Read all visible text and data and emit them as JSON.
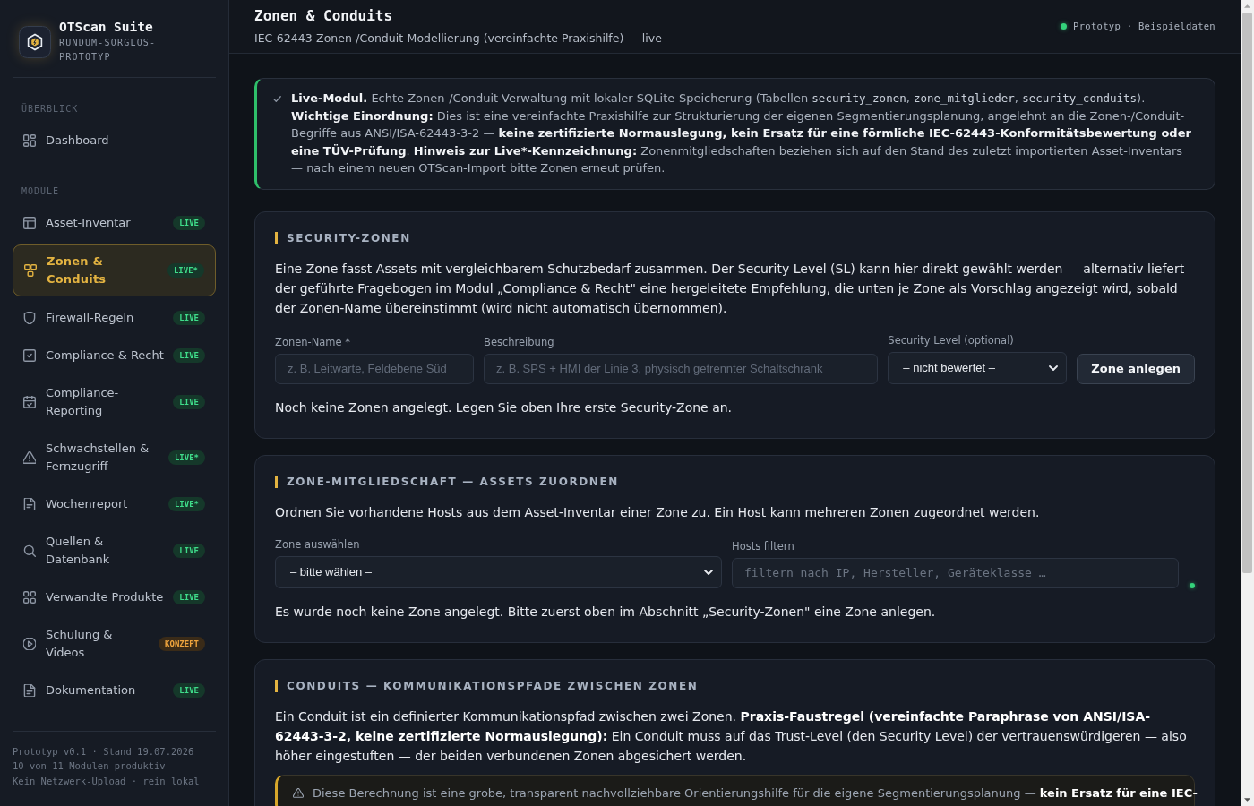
{
  "sidebar": {
    "brand": {
      "title": "OTScan Suite",
      "subtitle": "RUNDUM-SORGLOS-PROTOTYP"
    },
    "groups": [
      {
        "heading": "ÜBERBLICK",
        "items": [
          {
            "label": "Dashboard",
            "selected": false
          }
        ]
      },
      {
        "heading": "MODULE",
        "items": [
          {
            "label": "Asset-Inventar",
            "selected": false,
            "badge": {
              "text": "LIVE",
              "kind": "live"
            }
          },
          {
            "label": "Zonen & Conduits",
            "selected": true,
            "badge": {
              "text": "LIVE*",
              "kind": "live"
            }
          },
          {
            "label": "Firewall-Regeln",
            "selected": false,
            "badge": {
              "text": "LIVE",
              "kind": "live"
            }
          },
          {
            "label": "Compliance & Recht",
            "selected": false,
            "badge": {
              "text": "LIVE",
              "kind": "live"
            }
          },
          {
            "label": "Compliance-Reporting",
            "selected": false,
            "badge": {
              "text": "LIVE",
              "kind": "live"
            }
          },
          {
            "label": "Schwachstellen & Fernzugriff",
            "selected": false,
            "badge": {
              "text": "LIVE*",
              "kind": "live"
            }
          },
          {
            "label": "Wochenreport",
            "selected": false,
            "badge": {
              "text": "LIVE*",
              "kind": "live"
            }
          },
          {
            "label": "Quellen & Datenbank",
            "selected": false,
            "badge": {
              "text": "LIVE",
              "kind": "live"
            }
          },
          {
            "label": "Verwandte Produkte",
            "selected": false,
            "badge": {
              "text": "LIVE",
              "kind": "live"
            }
          },
          {
            "label": "Schulung & Videos",
            "selected": false,
            "badge": {
              "text": "KONZEPT",
              "kind": "concept"
            }
          },
          {
            "label": "Dokumentation",
            "selected": false,
            "badge": {
              "text": "LIVE",
              "kind": "live"
            }
          }
        ]
      }
    ],
    "footer": [
      "Prototyp v0.1 · Stand 19.07.2026",
      "10 von 11 Modulen produktiv",
      "Kein Netzwerk-Upload · rein lokal"
    ]
  },
  "header": {
    "title": "Zonen & Conduits",
    "subtitle": "IEC-62443-Zonen-/Conduit-Modellierung (vereinfachte Praxishilfe) — live",
    "status": "Prototyp · Beispieldaten"
  },
  "notice": {
    "segments": [
      {
        "kind": "bold",
        "text": "Live-Modul."
      },
      {
        "kind": "text",
        "text": " Echte Zonen-/Conduit-Verwaltung mit lokaler SQLite-Speicherung (Tabellen "
      },
      {
        "kind": "code",
        "text": "security_zonen"
      },
      {
        "kind": "text",
        "text": ", "
      },
      {
        "kind": "code",
        "text": "zone_mitglieder"
      },
      {
        "kind": "text",
        "text": ", "
      },
      {
        "kind": "code",
        "text": "security_conduits"
      },
      {
        "kind": "text",
        "text": "). "
      },
      {
        "kind": "bold",
        "text": "Wichtige Einordnung:"
      },
      {
        "kind": "text",
        "text": " Dies ist eine vereinfachte Praxishilfe zur Strukturierung der eigenen Segmentierungsplanung, angelehnt an die Zonen-/Conduit-Begriffe aus ANSI/ISA-62443-3-2 — "
      },
      {
        "kind": "bold",
        "text": "keine zertifizierte Normauslegung, kein Ersatz für eine förmliche IEC-62443-Konformitätsbewertung oder eine TÜV-Prüfung"
      },
      {
        "kind": "text",
        "text": ". "
      },
      {
        "kind": "bold",
        "text": "Hinweis zur Live*-Kennzeichnung:"
      },
      {
        "kind": "text",
        "text": " Zonenmitgliedschaften beziehen sich auf den Stand des zuletzt importierten Asset-Inventars — nach einem neuen OTScan-Import bitte Zonen erneut prüfen."
      }
    ]
  },
  "sections": [
    {
      "title": "SECURITY-ZONEN",
      "description": "Eine Zone fasst Assets mit vergleichbarem Schutzbedarf zusammen. Der Security Level (SL) kann hier direkt gewählt werden — alternativ liefert der geführte Fragebogen im Modul „Compliance & Recht\" eine hergeleitete Empfehlung, die unten je Zone als Vorschlag angezeigt wird, sobald der Zonen-Name übereinstimmt (wird nicht automatisch übernommen).",
      "fields": [
        {
          "kind": "input",
          "label": "Zonen-Name *",
          "placeholder": "z. B. Leitwarte, Feldebene Süd"
        },
        {
          "kind": "input",
          "label": "Beschreibung",
          "placeholder": "z. B. SPS + HMI der Linie 3, physisch getrennter Schaltschrank"
        },
        {
          "kind": "select",
          "label": "Security Level (optional)",
          "value": "– nicht bewertet –"
        },
        {
          "kind": "button",
          "label": "Zone anlegen"
        }
      ],
      "note": "Noch keine Zonen angelegt. Legen Sie oben Ihre erste Security-Zone an."
    },
    {
      "title": "ZONE-MITGLIEDSCHAFT — ASSETS ZUORDNEN",
      "description": "Ordnen Sie vorhandene Hosts aus dem Asset-Inventar einer Zone zu. Ein Host kann mehreren Zonen zugeordnet werden.",
      "fields": [
        {
          "kind": "select",
          "label": "Zone auswählen",
          "value": "– bitte wählen –"
        },
        {
          "kind": "filter",
          "label": "Hosts filtern",
          "placeholder": "filtern nach IP, Hersteller, Geräteklasse …"
        },
        {
          "kind": "indicator"
        }
      ],
      "note": "Es wurde noch keine Zone angelegt. Bitte zuerst oben im Abschnitt „Security-Zonen\" eine Zone anlegen."
    },
    {
      "title": "CONDUITS — KOMMUNIKATIONSPFADE ZWISCHEN ZONEN",
      "description": "Ein Conduit ist ein definierter Kommunikationspfad zwischen zwei Zonen. **Praxis-Faustregel (vereinfachte Paraphrase von ANSI/ISA-62443-3-2, keine zertifizierte Normauslegung):** Ein Conduit muss auf das Trust-Level (den Security Level) der vertrauenswürdigeren — also höher eingestuften — der beiden verbundenen Zonen abgesichert werden.",
      "warning": "Diese Berechnung ist eine grobe, transparent nachvollziehbare Orientierungshilfe für die eigene Segmentierungsplanung — **kein Ersatz für eine IEC-**"
    }
  ]
}
